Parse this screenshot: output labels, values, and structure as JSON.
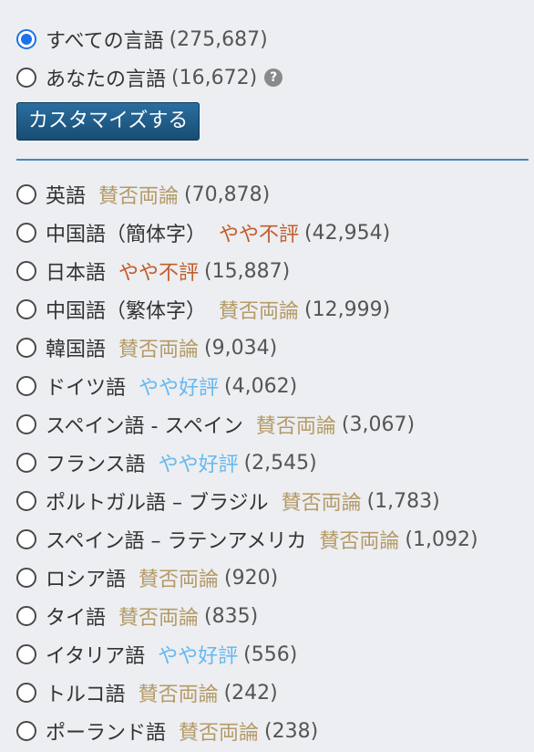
{
  "filters": [
    {
      "label": "すべての言語",
      "count": "(275,687)",
      "checked": true
    },
    {
      "label": "あなたの言語",
      "count": "(16,672)",
      "checked": false,
      "help": "?"
    }
  ],
  "customize_button": "カスタマイズする",
  "colors": {
    "mixed": "#b59a67",
    "mostly_negative": "#c35c2c",
    "mostly_positive": "#66b8f0",
    "radio_checked": "#1a73e8",
    "divider": "#4a86b5",
    "button_bg": "#1f5e8c"
  },
  "languages": [
    {
      "name": "英語",
      "rating": "賛否両論",
      "rating_type": "mixed",
      "count": "(70,878)"
    },
    {
      "name": "中国語（簡体字）",
      "rating": "やや不評",
      "rating_type": "mostly_negative",
      "count": "(42,954)"
    },
    {
      "name": "日本語",
      "rating": "やや不評",
      "rating_type": "mostly_negative",
      "count": "(15,887)"
    },
    {
      "name": "中国語（繁体字）",
      "rating": "賛否両論",
      "rating_type": "mixed",
      "count": "(12,999)"
    },
    {
      "name": "韓国語",
      "rating": "賛否両論",
      "rating_type": "mixed",
      "count": "(9,034)"
    },
    {
      "name": "ドイツ語",
      "rating": "やや好評",
      "rating_type": "mostly_positive",
      "count": "(4,062)"
    },
    {
      "name": "スペイン語 - スペイン",
      "rating": "賛否両論",
      "rating_type": "mixed",
      "count": "(3,067)"
    },
    {
      "name": "フランス語",
      "rating": "やや好評",
      "rating_type": "mostly_positive",
      "count": "(2,545)"
    },
    {
      "name": "ポルトガル語 – ブラジル",
      "rating": "賛否両論",
      "rating_type": "mixed",
      "count": "(1,783)"
    },
    {
      "name": "スペイン語 – ラテンアメリカ",
      "rating": "賛否両論",
      "rating_type": "mixed",
      "count": "(1,092)"
    },
    {
      "name": "ロシア語",
      "rating": "賛否両論",
      "rating_type": "mixed",
      "count": "(920)"
    },
    {
      "name": "タイ語",
      "rating": "賛否両論",
      "rating_type": "mixed",
      "count": "(835)"
    },
    {
      "name": "イタリア語",
      "rating": "やや好評",
      "rating_type": "mostly_positive",
      "count": "(556)"
    },
    {
      "name": "トルコ語",
      "rating": "賛否両論",
      "rating_type": "mixed",
      "count": "(242)"
    },
    {
      "name": "ポーランド語",
      "rating": "賛否両論",
      "rating_type": "mixed",
      "count": "(238)"
    }
  ]
}
